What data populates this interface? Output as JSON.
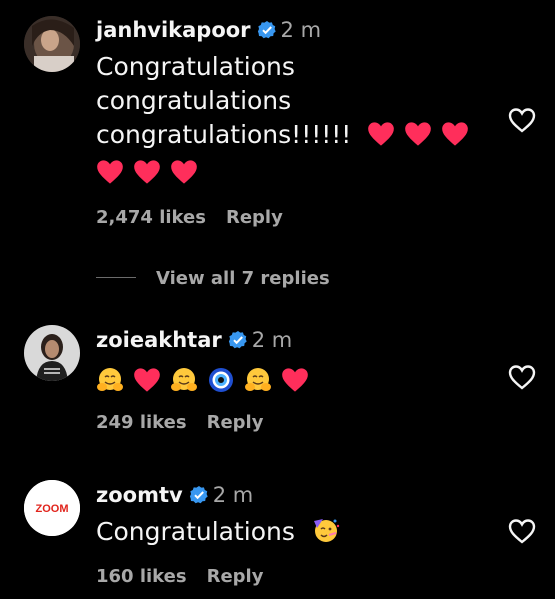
{
  "comments": [
    {
      "username": "janhvikapoor",
      "time": "2 m",
      "text_lines": [
        "Congratulations",
        "congratulations",
        "congratulations!!!!!!"
      ],
      "emoji_sequence_line3": [
        "heart",
        "heart",
        "heart"
      ],
      "emoji_sequence_line4": [
        "heart",
        "heart",
        "heart"
      ],
      "likes": "2,474 likes",
      "reply_label": "Reply",
      "view_replies": "View all 7 replies"
    },
    {
      "username": "zoieakhtar",
      "time": "2 m",
      "emojis": [
        "hugging-face",
        "heart",
        "hugging-face",
        "nazar-amulet",
        "hugging-face",
        "heart"
      ],
      "likes": "249 likes",
      "reply_label": "Reply"
    },
    {
      "username": "zoomtv",
      "time": "2 m",
      "text": "Congratulations",
      "emoji": "partying-face",
      "likes": "160 likes",
      "reply_label": "Reply",
      "avatar_text": "ZOOM"
    }
  ],
  "colors": {
    "background": "#000000",
    "text": "#f5f5f5",
    "muted": "#a8a8a8",
    "verified": "#3897f0",
    "heart": "#ff2e5b",
    "zoom_brand": "#e1241c"
  }
}
